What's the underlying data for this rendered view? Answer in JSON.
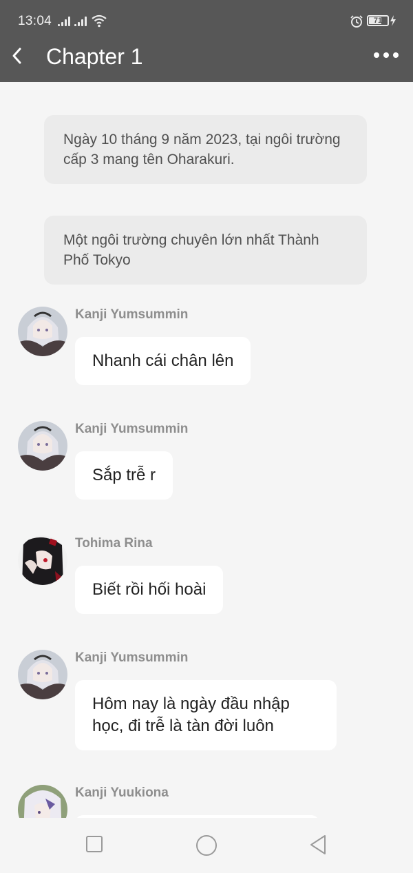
{
  "status": {
    "time": "13:04",
    "battery": "71",
    "battery_level": 0.71
  },
  "header": {
    "title": "Chapter 1",
    "back_icon": "back-arrow-icon",
    "more_icon": "more-horizontal-icon"
  },
  "narrations": [
    {
      "text": "Ngày 10 tháng 9 năm 2023, tại ngôi trường cấp 3 mang tên Oharakuri."
    },
    {
      "text": "Một ngôi trường chuyên lớn nhất Thành Phố Tokyo"
    }
  ],
  "messages": [
    {
      "sender": "Kanji Yumsummin",
      "text": "Nhanh cái chân lên"
    },
    {
      "sender": "Kanji Yumsummin",
      "text": "Sắp trễ r"
    },
    {
      "sender": "Tohima Rina",
      "text": "Biết rồi hối hoài"
    },
    {
      "sender": "Kanji Yumsummin",
      "text": "Hôm nay là ngày đầu nhập học, đi trễ là tàn đời luôn"
    },
    {
      "sender": "Kanji Yuukiona",
      "text": ""
    }
  ],
  "navbar": {
    "recent_icon": "square-icon",
    "home_icon": "circle-icon",
    "back_icon": "triangle-back-icon"
  },
  "colors": {
    "header_bg": "#575757",
    "page_bg": "#f5f5f5",
    "narration_bg": "#ebebeb",
    "bubble_bg": "#ffffff"
  }
}
